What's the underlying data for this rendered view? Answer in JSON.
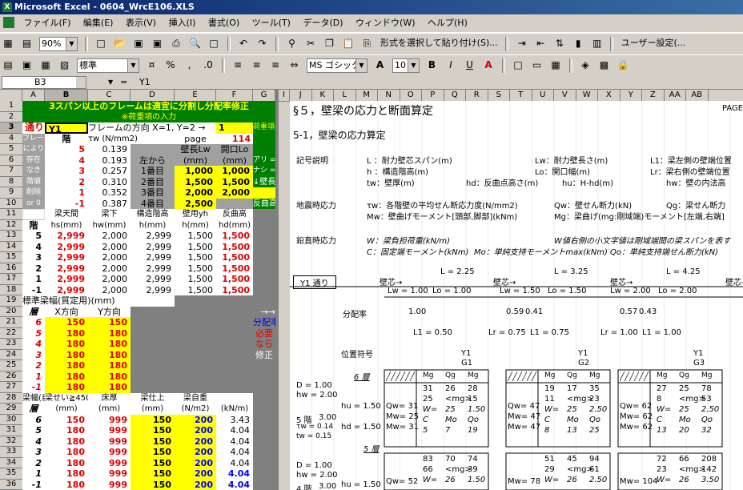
{
  "window": {
    "title": "Microsoft Excel - 0604_WrcE106.XLS"
  },
  "menu": [
    "ファイル(F)",
    "編集(E)",
    "表示(V)",
    "挿入(I)",
    "書式(O)",
    "ツール(T)",
    "データ(D)",
    "ウィンドウ(W)",
    "ヘルプ(H)"
  ],
  "toolbar1": {
    "zoom": "90%",
    "paste_special": "形式を選択して貼り付け(S)...",
    "user_settings": "ユーザー設定(..."
  },
  "toolbar2": {
    "style": "標準",
    "font": "MS ゴシック",
    "size": "10"
  },
  "formula": {
    "cell": "B3",
    "eq": "=",
    "value": "Y1"
  },
  "columns_left": [
    "A",
    "B",
    "C",
    "D",
    "E",
    "F",
    "G",
    "H"
  ],
  "columns_right": [
    "I",
    "J",
    "K",
    "L",
    "M",
    "N",
    "O",
    "P",
    "Q",
    "R",
    "S",
    "T",
    "U",
    "V",
    "W",
    "X",
    "Y",
    "Z",
    "AA",
    "AB"
  ],
  "rows": [
    "1",
    "2",
    "3",
    "4",
    "5",
    "6",
    "7",
    "8",
    "9",
    "10",
    "11",
    "12",
    "13",
    "14",
    "15",
    "16",
    "17",
    "18",
    "19",
    "20",
    "21",
    "22",
    "23",
    "24",
    "25",
    "26",
    "27",
    "28",
    "29",
    "30",
    "31",
    "32",
    "33",
    "34",
    "35",
    "36"
  ],
  "left": {
    "r1": "3スパン以上のフレームは適宜に分割し分配率修正",
    "r2": "※荷重項の入力",
    "r3_label": "通り",
    "r3_value": "Y1",
    "r3_dir": "フレームの方向 X=1, Y=2 →",
    "r3_dirval": "1",
    "r3_note": "荷重項の入力",
    "r4": [
      "フレーム",
      "階",
      "τw (N/mm2)",
      "page",
      "114"
    ],
    "r5to10_a": [
      "により",
      "存在",
      "なき",
      "階値",
      "削除",
      "or 0"
    ],
    "r5to10_b": [
      "5",
      "4",
      "3",
      "2",
      "1",
      "-1"
    ],
    "r5to10_c": [
      "0.139",
      "0.193",
      "0.257",
      "0.310",
      "0.352",
      "0.387"
    ],
    "r6_d": "左から",
    "r6_e": "壁長Lw",
    "r6_f": "開口Lo",
    "r7_unit_e": "(mm)",
    "r7_unit_f": "(mm)",
    "r7to10_d": [
      "1番目",
      "2番目",
      "3番目",
      "4番目"
    ],
    "r7to10_e": [
      "1,000",
      "1,500",
      "2,000",
      "2,500"
    ],
    "r7to10_f": [
      "1,000",
      "1,500",
      "2,000",
      ""
    ],
    "g_notes": [
      "アリ = 1",
      "ナシ = 0",
      "↓壁長等",
      "反曲高↓"
    ],
    "r11": [
      "梁天間",
      "梁下",
      "構造階高",
      "壁用yh",
      "反曲高"
    ],
    "r12": [
      "階",
      "hs(mm)",
      "hw(mm)",
      "h(mm)",
      "h(mm)",
      "hd(mm)"
    ],
    "r13to18": [
      [
        "5",
        "2,999",
        "2,000",
        "2,999",
        "1,500",
        "1,500"
      ],
      [
        "4",
        "2,999",
        "2,000",
        "2,999",
        "1,500",
        "1,500"
      ],
      [
        "3",
        "2,999",
        "2,000",
        "2,999",
        "1,500",
        "1,500"
      ],
      [
        "2",
        "2,999",
        "2,000",
        "2,999",
        "1,500",
        "1,500"
      ],
      [
        "1",
        "2,999",
        "2,000",
        "2,999",
        "1,500",
        "1,500"
      ],
      [
        "-1",
        "2,999",
        "2,000",
        "2,999",
        "1,500",
        "1,500"
      ]
    ],
    "r19": "標準梁幅(質定用)(mm)",
    "r20": [
      "層",
      "X方向",
      "Y方向"
    ],
    "r21to27": [
      [
        "6",
        "150",
        "150"
      ],
      [
        "5",
        "180",
        "180"
      ],
      [
        "4",
        "180",
        "180"
      ],
      [
        "3",
        "180",
        "180"
      ],
      [
        "2",
        "180",
        "180"
      ],
      [
        "1",
        "180",
        "180"
      ],
      [
        "-1",
        "180",
        "180"
      ]
    ],
    "g_block": [
      "→→",
      "分配率",
      "必要",
      "なら",
      "修正"
    ],
    "r28": [
      "梁幅(自重用)",
      "梁せい≧450",
      "床厚",
      "梁仕上",
      "梁自重"
    ],
    "r29": [
      "層",
      "(mm)",
      "(mm)",
      "(mm)",
      "(N/m2)",
      "(kN/m)"
    ],
    "r30to36": [
      [
        "6",
        "150",
        "999",
        "150",
        "200",
        "3.43"
      ],
      [
        "5",
        "180",
        "999",
        "150",
        "200",
        "4.04"
      ],
      [
        "4",
        "180",
        "999",
        "150",
        "200",
        "4.04"
      ],
      [
        "3",
        "180",
        "999",
        "150",
        "200",
        "4.04"
      ],
      [
        "2",
        "180",
        "999",
        "150",
        "200",
        "4.04"
      ],
      [
        "1",
        "180",
        "999",
        "150",
        "200",
        "4.04"
      ],
      [
        "-1",
        "180",
        "999",
        "150",
        "200",
        "4.04"
      ]
    ]
  },
  "right": {
    "title": "§５，壁梁の応力と断面算定",
    "page": "PAGE",
    "sub": "5-1，壁梁の応力算定",
    "legend_label": "記号説明",
    "legend": [
      [
        "L ：耐力壁芯スパン(m)",
        "Lw：耐力壁長さ(m)",
        "L1：梁左側の壁端位置"
      ],
      [
        "h ：構造階高(m)",
        "Lo：開口幅(m)",
        "Lr：梁右側の壁端位置"
      ],
      [
        "tw：壁厚(m)",
        "hd：反曲点高さ(m)",
        "hu：H-hd(m)",
        "hw：壁の内法高"
      ]
    ],
    "seismic_label": "地震時応力",
    "seismic": [
      [
        "τw：各階壁の平均せん断応力度(N/mm2)",
        "Qw：壁せん断力(kN)",
        "Qg：梁せん断力"
      ],
      [
        "Mw：壁曲げモーメント[頭部,脚部](kNm)",
        "Mg：梁曲げ(mg:剛域端)モーメント[左端,右端]"
      ]
    ],
    "vertical_label": "鉛直時応力",
    "vertical": [
      [
        "W：梁負担荷重(kN/m)",
        "W値右側の小文字値は剛域端間の梁スパンを表す"
      ],
      [
        "C：固定端モーメント(kNm)",
        "Mo：単純支持モーメントmax(kNm)",
        "Qo：単純支持端せん断力(kN)"
      ]
    ],
    "frame_label": "Y1 通り",
    "spans": [
      "L = 2.25",
      "L = 3.25",
      "L = 4.25"
    ],
    "wall_core": [
      "壁芯→",
      "壁芯→",
      "壁芯→",
      "壁芯→"
    ],
    "lw_lo": [
      "Lw = 1.00",
      "Lo = 1.00",
      "Lw = 1.50",
      "Lo = 1.50",
      "Lw = 2.00",
      "Lo = 2.00"
    ],
    "dist_label": "分配率",
    "dist": [
      "1.00",
      "0.59",
      "0.41",
      "0.57",
      "0.43"
    ],
    "l1lr": [
      "L1 = 0.50",
      "Lr = 0.75",
      "L1 = 0.75",
      "Lr = 1.00",
      "L1 = 1.00"
    ],
    "pos_label": "位置符号",
    "beams": [
      [
        "Y1",
        "G1"
      ],
      [
        "Y1",
        "G2"
      ],
      [
        "Y1",
        "G3"
      ]
    ],
    "floor6": "6 層",
    "floor5": "5 層",
    "mq": [
      "Mg",
      "Qg",
      "Mg"
    ],
    "left_block_6": [
      "D = 1.00",
      "hw = 2.00"
    ],
    "left_block_5": [
      "5 階",
      "τw = 0.14",
      "tw = 0.15"
    ],
    "hu_hd": [
      "hu = 1.50",
      "3.00",
      "hd = 1.50"
    ],
    "g1_6": [
      [
        "31",
        "26",
        "28"
      ],
      [
        "25",
        "<mg>",
        "15"
      ],
      [
        "W=",
        "25",
        "1.50"
      ],
      [
        "C",
        "Mo",
        "Qo"
      ],
      [
        "5",
        "7",
        "19"
      ]
    ],
    "g2_6": [
      [
        "19",
        "17",
        "35"
      ],
      [
        "11",
        "<mg>",
        "23"
      ],
      [
        "W=",
        "25",
        "2.50"
      ],
      [
        "C",
        "Mo",
        "Qo"
      ],
      [
        "8",
        "13",
        "25"
      ]
    ],
    "g3_6": [
      [
        "27",
        "25",
        "78"
      ],
      [
        "8",
        "<mg>",
        "53"
      ],
      [
        "W=",
        "25",
        "2.50"
      ],
      [
        "C",
        "Mo",
        "Qo"
      ],
      [
        "13",
        "20",
        "32"
      ]
    ],
    "qw_6": [
      "Qw= 31",
      "Mw= 25",
      "Mw= 31"
    ],
    "qw_6b": [
      "Qw= 47",
      "Mw= 47",
      "Mw= 47"
    ],
    "qw_6c": [
      "Qw= 62",
      "Mw= 62",
      "Mw= 62"
    ],
    "lower": [
      "D = 1.00",
      "hw = 2.00",
      "hu = 1.50",
      "4 階",
      "3.00"
    ],
    "g1_5": [
      [
        "83",
        "70",
        "74"
      ],
      [
        "66",
        "<mg>",
        "39"
      ],
      [
        "W=",
        "26",
        "1.50"
      ]
    ],
    "g2_5": [
      [
        "51",
        "45",
        "94"
      ],
      [
        "29",
        "<mg>",
        "61"
      ],
      [
        "W=",
        "26",
        "2.50"
      ]
    ],
    "g3_5": [
      [
        "72",
        "66",
        "208"
      ],
      [
        "23",
        "<mg>",
        "142"
      ],
      [
        "W=",
        "26",
        "3.50"
      ]
    ],
    "qw_5": [
      "Qw= 52",
      "Mw= 78",
      "Mw= 104"
    ]
  }
}
